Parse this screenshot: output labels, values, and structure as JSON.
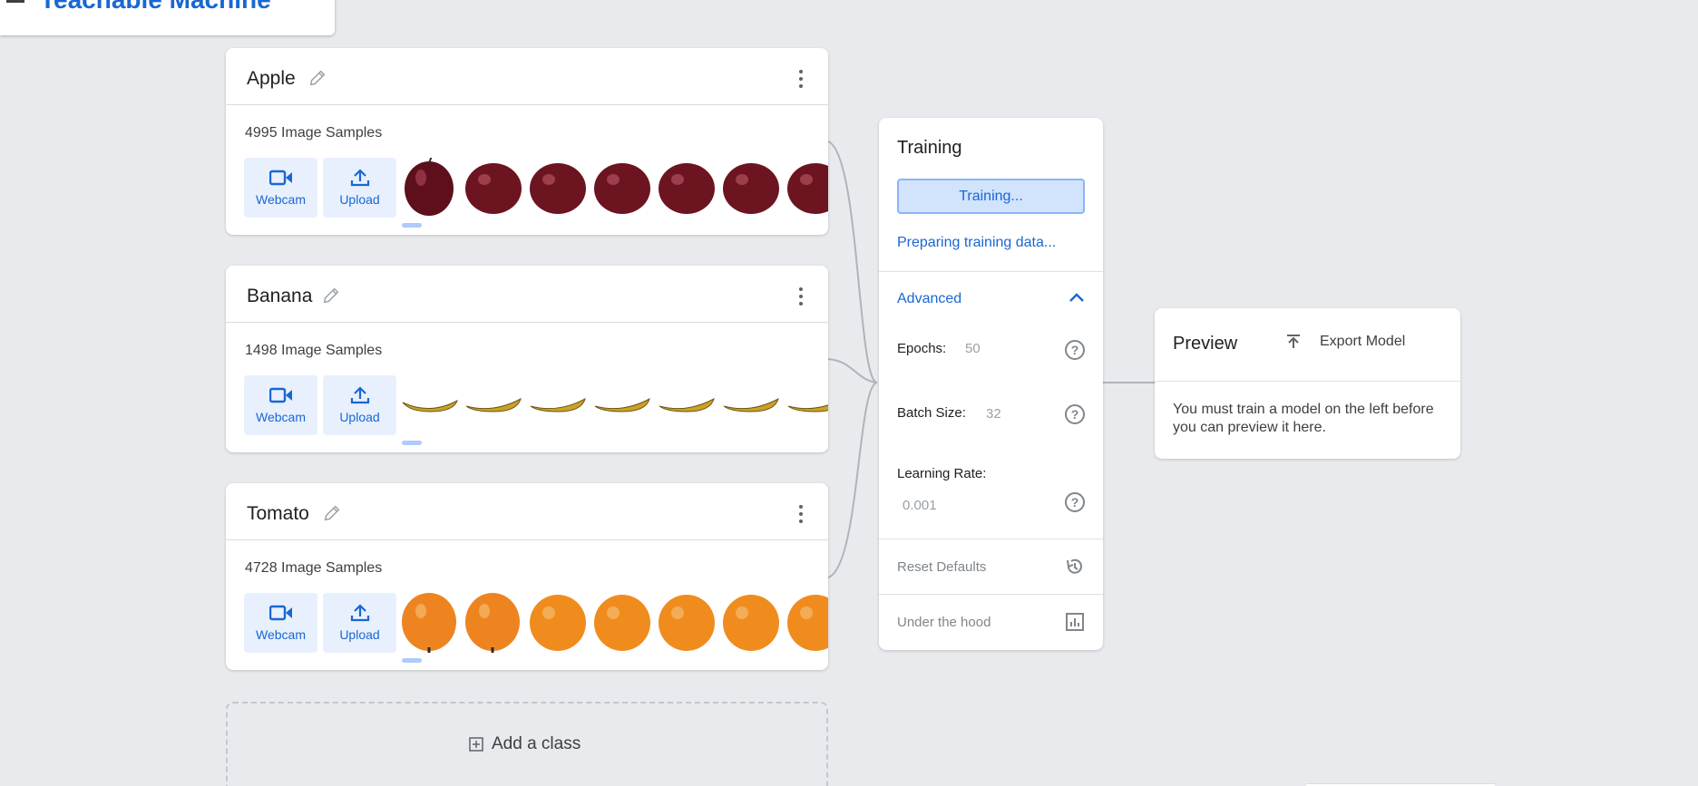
{
  "app": {
    "title": "Teachable Machine"
  },
  "classes": [
    {
      "name": "Apple",
      "sample_count": "4995 Image Samples",
      "thumb_color": "#6d1421",
      "thumb_shape": "apple-icon"
    },
    {
      "name": "Banana",
      "sample_count": "1498 Image Samples",
      "thumb_color": "#c9a227",
      "thumb_shape": "banana-icon"
    },
    {
      "name": "Tomato",
      "sample_count": "4728 Image Samples",
      "thumb_color": "#f08c1e",
      "thumb_shape": "tomato-icon"
    }
  ],
  "source_buttons": {
    "webcam": "Webcam",
    "upload": "Upload"
  },
  "add_class": {
    "label": "Add a class"
  },
  "training": {
    "title": "Training",
    "button_label": "Training...",
    "status": "Preparing training data...",
    "advanced_label": "Advanced",
    "epochs_label": "Epochs:",
    "epochs_value": "50",
    "batch_label": "Batch Size:",
    "batch_value": "32",
    "lr_label": "Learning Rate:",
    "lr_value": "0.001",
    "reset_label": "Reset Defaults",
    "hood_label": "Under the hood"
  },
  "preview": {
    "title": "Preview",
    "export_label": "Export Model",
    "message": "You must train a model on the left before you can preview it here."
  },
  "colors": {
    "accent": "#1967d2",
    "accent_light": "#e8f0fe",
    "background": "#e8eaed"
  }
}
